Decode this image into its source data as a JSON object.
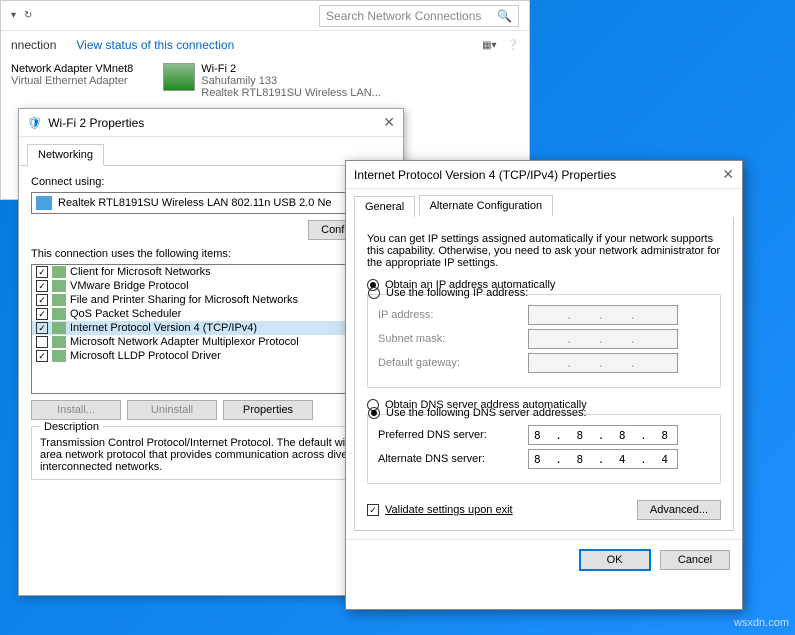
{
  "nc": {
    "search_placeholder": "Search Network Connections",
    "toolbar": {
      "connection": "nnection",
      "viewstatus": "View status of this connection"
    },
    "adapters": [
      {
        "name": "Network Adapter VMnet8",
        "sub": "Virtual Ethernet Adapter"
      },
      {
        "name": "Wi-Fi 2",
        "sub1": "Sahufamily  133",
        "sub2": "Realtek RTL8191SU Wireless LAN..."
      }
    ]
  },
  "props1": {
    "title": "Wi-Fi 2 Properties",
    "tab": "Networking",
    "connect_label": "Connect using:",
    "adapter": "Realtek RTL8191SU Wireless LAN 802.11n USB 2.0 Ne",
    "configure": "Configure...",
    "items_label": "This connection uses the following items:",
    "items": [
      {
        "c": true,
        "label": "Client for Microsoft Networks"
      },
      {
        "c": true,
        "label": "VMware Bridge Protocol"
      },
      {
        "c": true,
        "label": "File and Printer Sharing for Microsoft Networks"
      },
      {
        "c": true,
        "label": "QoS Packet Scheduler"
      },
      {
        "c": true,
        "label": "Internet Protocol Version 4 (TCP/IPv4)",
        "sel": true
      },
      {
        "c": false,
        "label": "Microsoft Network Adapter Multiplexor Protocol"
      },
      {
        "c": true,
        "label": "Microsoft LLDP Protocol Driver"
      }
    ],
    "install": "Install...",
    "uninstall": "Uninstall",
    "properties": "Properties",
    "desc_title": "Description",
    "desc": "Transmission Control Protocol/Internet Protocol. The default wide area network protocol that provides communication across diverse interconnected networks."
  },
  "props2": {
    "title": "Internet Protocol Version 4 (TCP/IPv4) Properties",
    "tabs": {
      "general": "General",
      "alt": "Alternate Configuration"
    },
    "hint": "You can get IP settings assigned automatically if your network supports this capability. Otherwise, you need to ask your network administrator for the appropriate IP settings.",
    "ip_auto": "Obtain an IP address automatically",
    "ip_manual": "Use the following IP address:",
    "ip_addr": "IP address:",
    "subnet": "Subnet mask:",
    "gateway": "Default gateway:",
    "dns_auto": "Obtain DNS server address automatically",
    "dns_manual": "Use the following DNS server addresses:",
    "pref_dns": "Preferred DNS server:",
    "alt_dns": "Alternate DNS server:",
    "pref_dns_val": "8 . 8 . 8 . 8",
    "alt_dns_val": "8 . 8 . 4 . 4",
    "validate": "Validate settings upon exit",
    "advanced": "Advanced...",
    "ok": "OK",
    "cancel": "Cancel"
  },
  "watermark": "wsxdn.com"
}
